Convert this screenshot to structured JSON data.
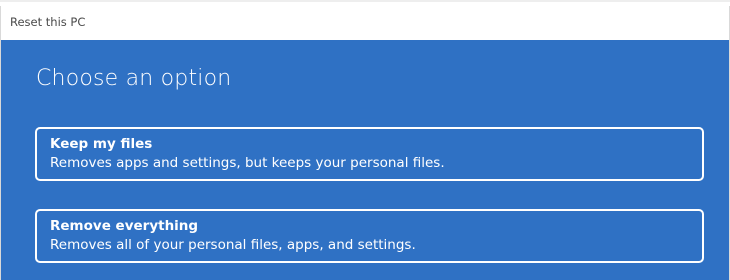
{
  "window": {
    "title": "Reset this PC"
  },
  "page": {
    "heading": "Choose an option"
  },
  "options": [
    {
      "title": "Keep my files",
      "description": "Removes apps and settings, but keeps your personal files."
    },
    {
      "title": "Remove everything",
      "description": "Removes all of your personal files, apps, and settings."
    }
  ],
  "colors": {
    "panel_background": "#2f71c4",
    "text": "#ffffff",
    "titlebar_background": "#ffffff",
    "titlebar_text": "#4a4a4a"
  }
}
